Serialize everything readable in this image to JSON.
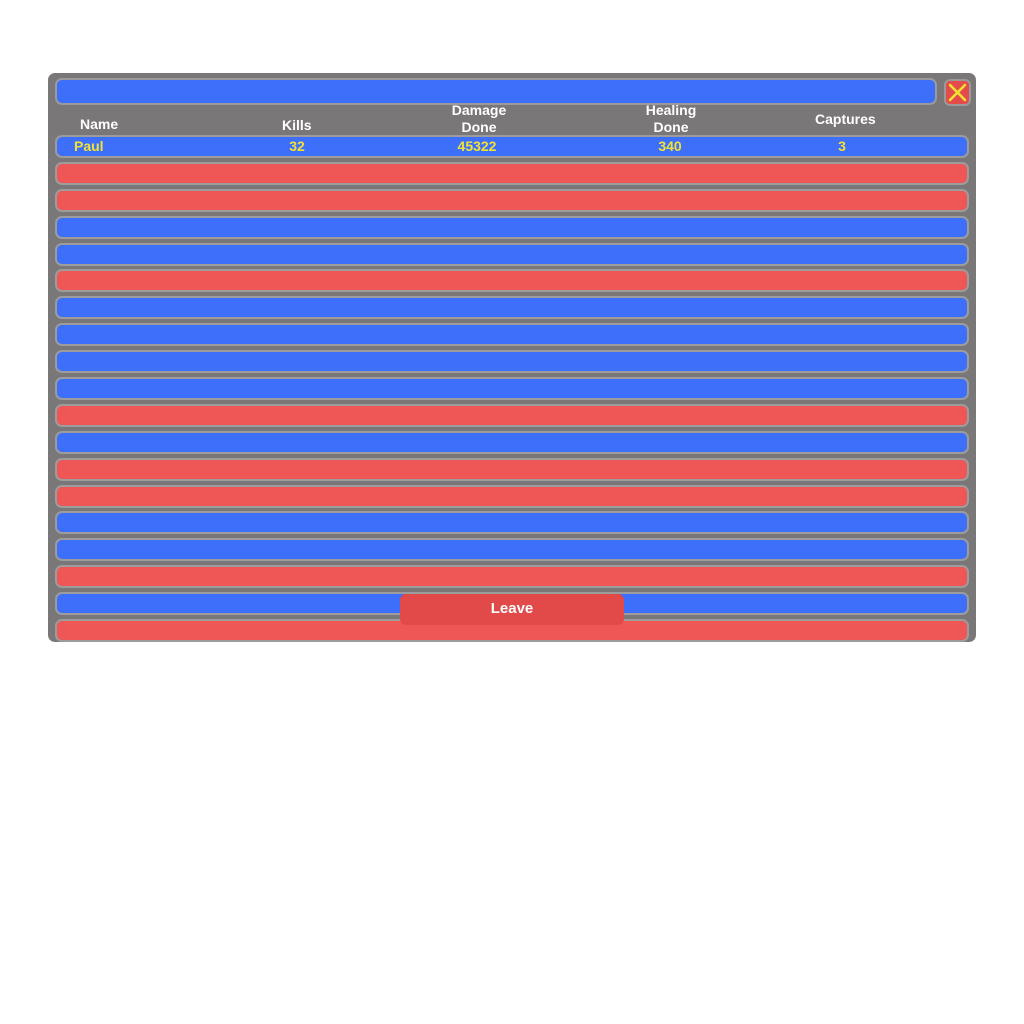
{
  "colors": {
    "panel_bg": "#7a7778",
    "team_blue": "#3e6ffa",
    "team_red": "#ef5757",
    "highlight_text": "#f2e233",
    "header_text": "#ffffff",
    "leave_button": "#e24a4a"
  },
  "title_bar": {
    "text": ""
  },
  "close_button": {
    "icon": "close-x-icon"
  },
  "columns": {
    "name": "Name",
    "kills": "Kills",
    "damage_line1": "Damage",
    "damage_line2": "Done",
    "healing_line1": "Healing",
    "healing_line2": "Done",
    "captures": "Captures"
  },
  "rows": [
    {
      "team": "blue",
      "name": "Paul",
      "kills": "32",
      "damage": "45322",
      "healing": "340",
      "captures": "3"
    },
    {
      "team": "red"
    },
    {
      "team": "red"
    },
    {
      "team": "blue"
    },
    {
      "team": "blue"
    },
    {
      "team": "red"
    },
    {
      "team": "blue"
    },
    {
      "team": "blue"
    },
    {
      "team": "blue"
    },
    {
      "team": "blue"
    },
    {
      "team": "red"
    },
    {
      "team": "blue"
    },
    {
      "team": "red"
    },
    {
      "team": "red"
    },
    {
      "team": "blue"
    },
    {
      "team": "blue"
    },
    {
      "team": "red"
    },
    {
      "team": "blue"
    },
    {
      "team": "red"
    }
  ],
  "leave_button": {
    "label": "Leave"
  }
}
